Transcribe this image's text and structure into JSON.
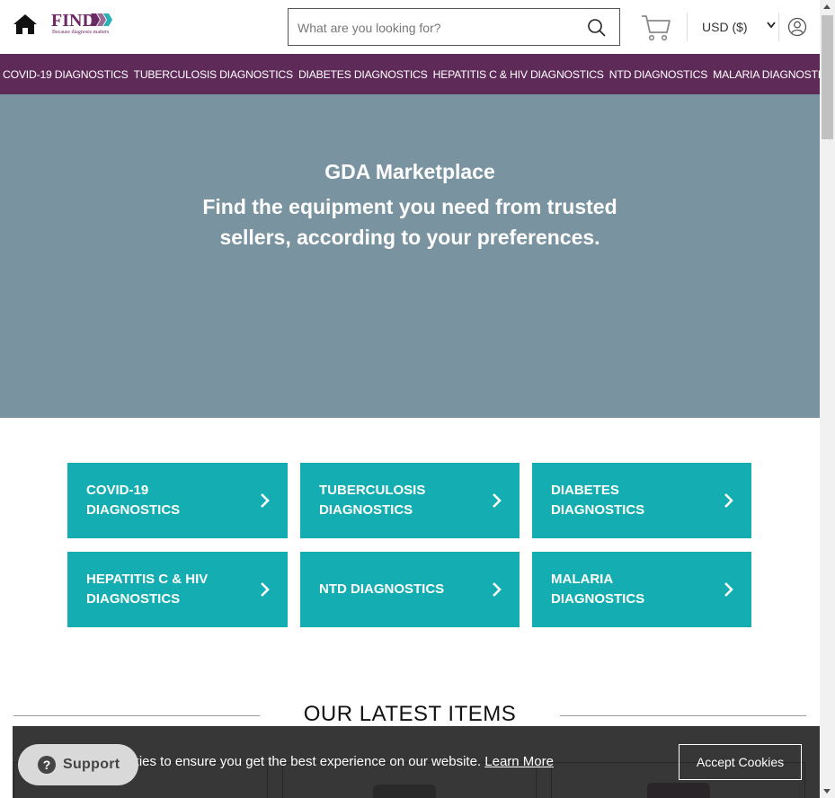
{
  "header": {
    "logo_text": "FIND",
    "logo_tagline": "Because diagnosis matters",
    "search_placeholder": "What are you looking for?",
    "currency": "USD ($)"
  },
  "nav": {
    "items": [
      "COVID-19 DIAGNOSTICS",
      "TUBERCULOSIS DIAGNOSTICS",
      "DIABETES DIAGNOSTICS",
      "HEPATITIS C & HIV DIAGNOSTICS",
      "NTD DIAGNOSTICS",
      "MALARIA DIAGNOSTICS"
    ]
  },
  "hero": {
    "title": "GDA Marketplace",
    "subtitle": "Find the equipment you need from trusted sellers, according to your preferences."
  },
  "categories": [
    "COVID-19 DIAGNOSTICS",
    "TUBERCULOSIS DIAGNOSTICS",
    "DIABETES DIAGNOSTICS",
    "HEPATITIS C & HIV DIAGNOSTICS",
    "NTD DIAGNOSTICS",
    "MALARIA DIAGNOSTICS"
  ],
  "latest": {
    "title": "OUR LATEST ITEMS"
  },
  "cookie": {
    "text": "okies to ensure you get the best experience on our website.",
    "learn_more": "Learn More",
    "accept": "Accept Cookies"
  },
  "support": {
    "label": "Support",
    "icon_glyph": "?"
  },
  "colors": {
    "brand_purple": "#5e2b58",
    "hero_bg": "#7994a0",
    "category_teal": "#14adb1"
  },
  "icons": [
    "home-icon",
    "search-icon",
    "cart-icon",
    "chevron-down-icon",
    "user-icon",
    "chevron-right-icon",
    "question-icon"
  ]
}
